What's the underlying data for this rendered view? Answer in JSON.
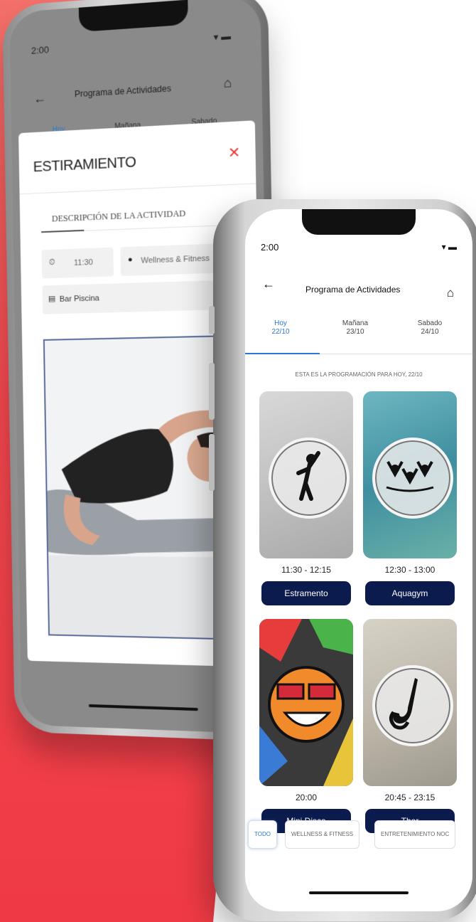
{
  "back_phone": {
    "status_time": "2:00",
    "header": {
      "title": "Programa de Actividades"
    },
    "tabs": [
      "Hoy",
      "Mañana",
      "Sabado"
    ],
    "modal": {
      "title": "ESTIRAMIENTO",
      "section_label": "DESCRIPCIÓN DE LA ACTIVIDAD",
      "time": "11:30",
      "category": "Wellness & Fitness",
      "location": "Bar Piscina"
    }
  },
  "front_phone": {
    "status_time": "2:00",
    "header": {
      "title": "Programa de Actividades"
    },
    "tabs": [
      {
        "label": "Hoy",
        "date": "22/10"
      },
      {
        "label": "Mañana",
        "date": "23/10"
      },
      {
        "label": "Sabado",
        "date": "24/10"
      }
    ],
    "info_text": "ESTA ES LA PROGRAMACIÓN PARA HOY, 22/10",
    "activities": [
      {
        "time": "11:30 - 12:15",
        "name": "Estramento"
      },
      {
        "time": "12:30 - 13:00",
        "name": "Aquagym"
      },
      {
        "time": "20:00",
        "name": "Mini Disco"
      },
      {
        "time": "20:45 - 23:15",
        "name": "Tbor"
      }
    ],
    "filters": [
      "TODO",
      "WELLNESS & FITNESS",
      "ENTRETENIMIENTO NOC"
    ]
  },
  "colors": {
    "accent_blue": "#2a78d6",
    "button_navy": "#0b1b4d",
    "close_red": "#e23b3b",
    "background_red": "#ef3a45"
  },
  "icons": [
    "back-arrow-icon",
    "home-icon",
    "close-icon",
    "clock-icon",
    "tag-icon",
    "document-icon",
    "wifi-icon",
    "battery-icon"
  ]
}
